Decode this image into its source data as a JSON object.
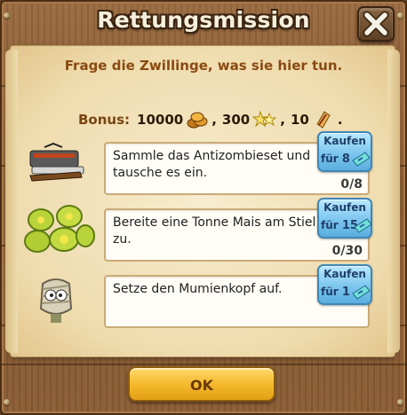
{
  "dialog": {
    "title": "Rettungsmission",
    "instruction": "Frage die Zwillinge, was sie hier tun.",
    "close_icon": "close-icon"
  },
  "bonus": {
    "label": "Bonus:",
    "coins": "10000",
    "coins_icon": "coins-icon",
    "sep1": ",",
    "xp": "300",
    "xp_icon": "star-icon",
    "sep2": ",",
    "energy": "10",
    "energy_icon": "energy-icon",
    "end": "."
  },
  "tasks": [
    {
      "text": "Sammle das Antizombieset und tausche es ein.",
      "progress": "0/8",
      "icon": "antizombie-kit-icon",
      "buy_label": "Kaufen",
      "buy_for": "für",
      "buy_price": "8",
      "currency_icon": "ticket-icon"
    },
    {
      "text": "Bereite eine Tonne Mais am Stiel zu.",
      "progress": "0/30",
      "icon": "corn-icon",
      "buy_label": "Kaufen",
      "buy_for": "für",
      "buy_price": "15",
      "currency_icon": "ticket-icon"
    },
    {
      "text": "Setze den Mumienkopf auf.",
      "progress": "",
      "icon": "mummy-head-icon",
      "buy_label": "Kaufen",
      "buy_for": "für",
      "buy_price": "1",
      "currency_icon": "ticket-icon"
    }
  ],
  "ok_button": {
    "label": "OK"
  },
  "colors": {
    "wood": "#80552e",
    "parchment": "#efdcae",
    "instruction_text": "#8a4a12",
    "buy_button": "#7cc6ee",
    "ok_button": "#f3b72a"
  }
}
